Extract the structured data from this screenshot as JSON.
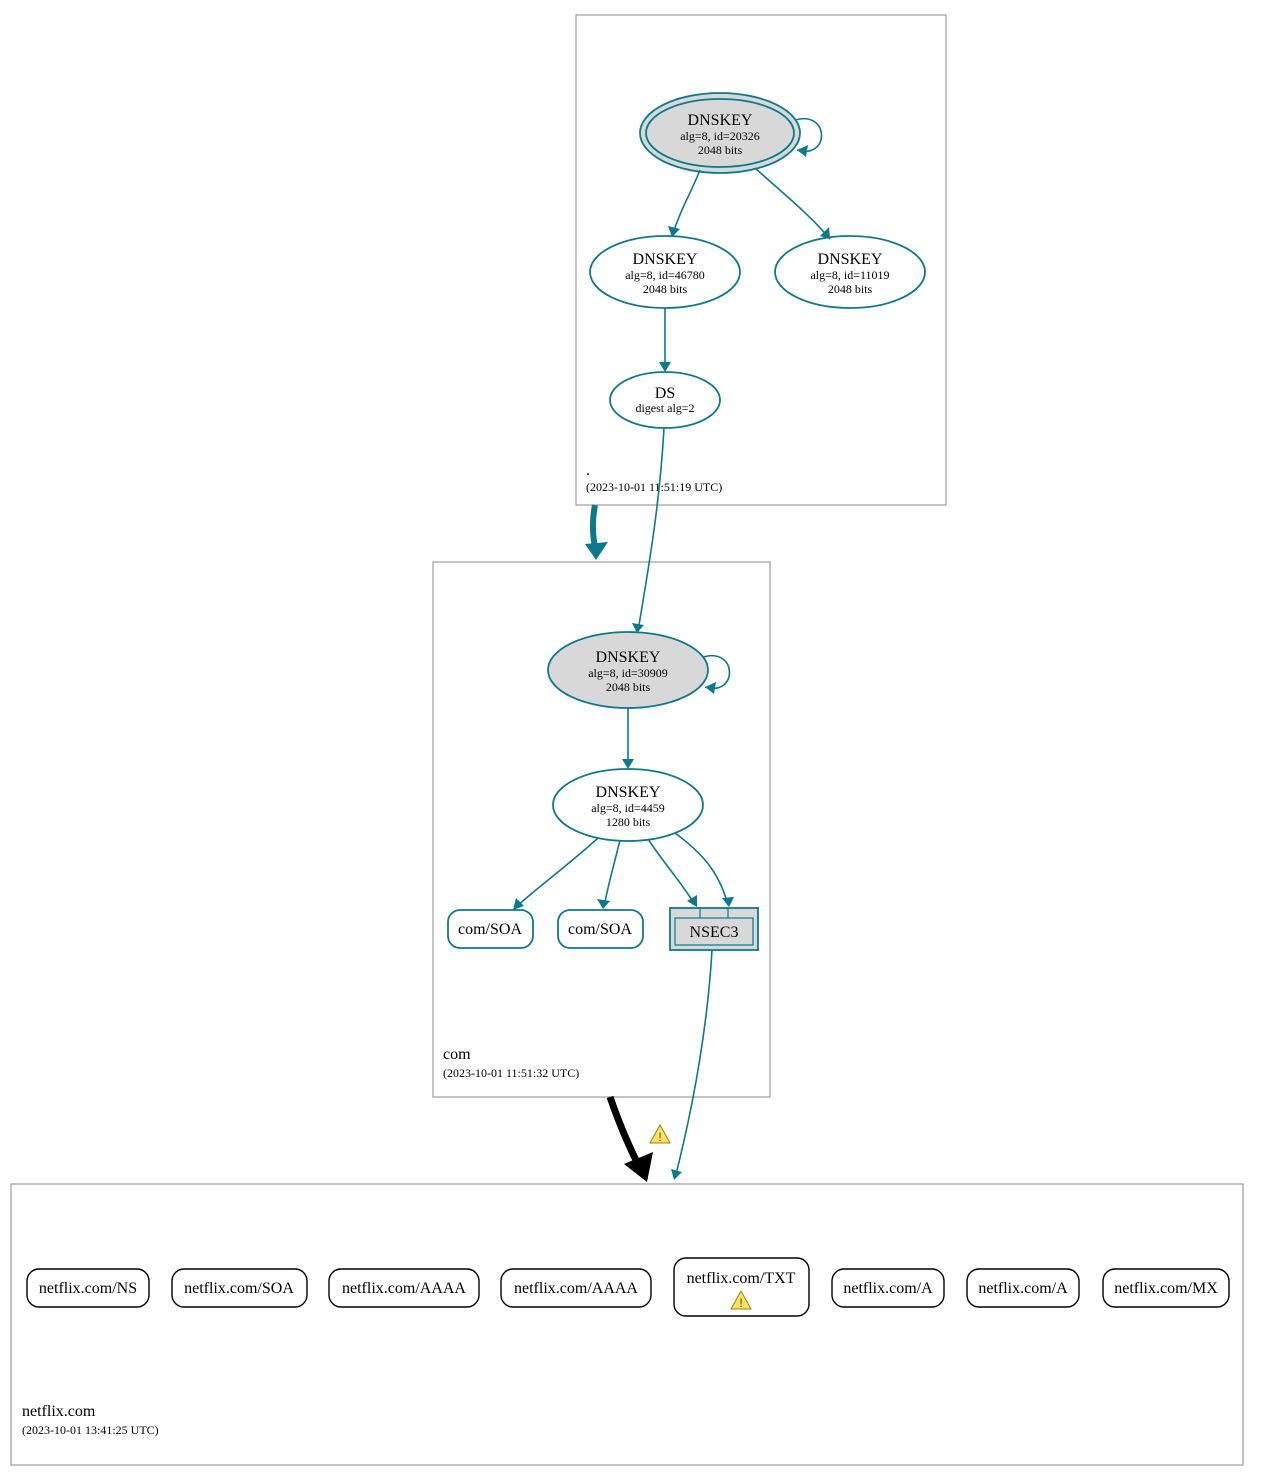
{
  "zones": {
    "root": {
      "label": ".",
      "timestamp": "(2023-10-01 11:51:19 UTC)",
      "ksk": {
        "title": "DNSKEY",
        "sub1": "alg=8, id=20326",
        "sub2": "2048 bits"
      },
      "zsk": {
        "title": "DNSKEY",
        "sub1": "alg=8, id=46780",
        "sub2": "2048 bits"
      },
      "zsk2": {
        "title": "DNSKEY",
        "sub1": "alg=8, id=11019",
        "sub2": "2048 bits"
      },
      "ds": {
        "title": "DS",
        "sub1": "digest alg=2"
      }
    },
    "com": {
      "label": "com",
      "timestamp": "(2023-10-01 11:51:32 UTC)",
      "ksk": {
        "title": "DNSKEY",
        "sub1": "alg=8, id=30909",
        "sub2": "2048 bits"
      },
      "zsk": {
        "title": "DNSKEY",
        "sub1": "alg=8, id=4459",
        "sub2": "1280 bits"
      },
      "soa1": "com/SOA",
      "soa2": "com/SOA",
      "nsec3": "NSEC3"
    },
    "netflix": {
      "label": "netflix.com",
      "timestamp": "(2023-10-01 13:41:25 UTC)",
      "records": [
        "netflix.com/NS",
        "netflix.com/SOA",
        "netflix.com/AAAA",
        "netflix.com/AAAA",
        "netflix.com/TXT",
        "netflix.com/A",
        "netflix.com/A",
        "netflix.com/MX"
      ]
    }
  }
}
